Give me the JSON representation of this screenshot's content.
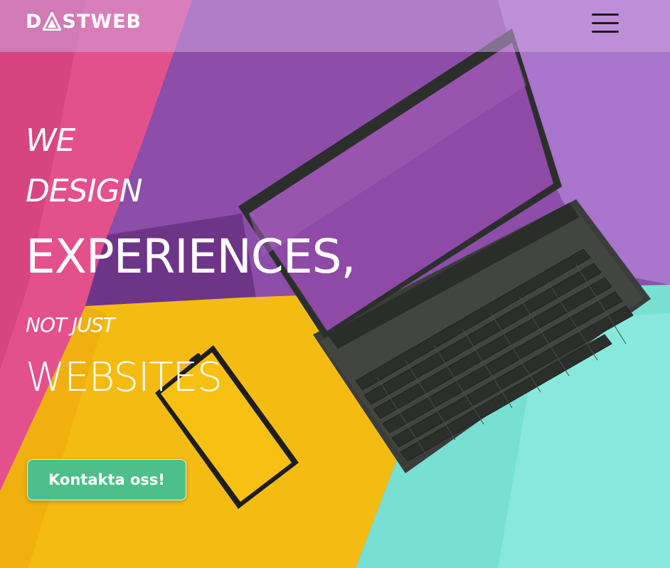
{
  "header": {
    "logo_text": "DASTWEB",
    "logo_parts": {
      "before": "D",
      "after": "STWEB"
    },
    "menu_icon": "hamburger-menu-icon"
  },
  "hero": {
    "lines": [
      "WE",
      "DESIGN",
      "EXPERIENCES,",
      "NOT JUST",
      "WEBSITES"
    ],
    "cta_label": "Kontakta oss!"
  },
  "colors": {
    "pink": "#e4508c",
    "purple": "#8a4aa8",
    "lavender": "#b48ad6",
    "yellow": "#f5bd16",
    "turquoise": "#7ee3d6",
    "cta": "#4cbf8a",
    "header_overlay": "rgba(205,165,225,0.55)"
  }
}
